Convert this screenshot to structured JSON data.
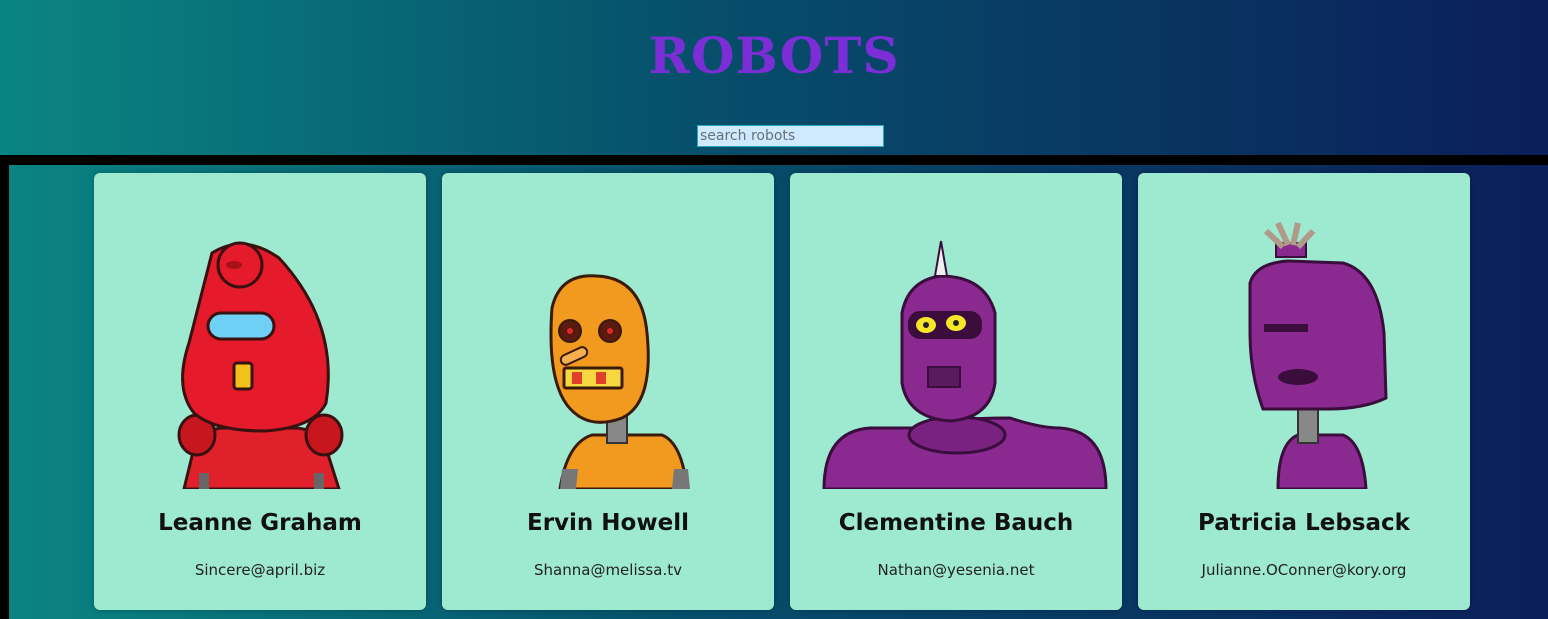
{
  "header": {
    "title": "ROBOTS",
    "search_placeholder": "search robots",
    "search_value": ""
  },
  "robots": [
    {
      "name": "Leanne Graham",
      "email": "Sincere@april.biz",
      "avatar": "red-robot-avatar"
    },
    {
      "name": "Ervin Howell",
      "email": "Shanna@melissa.tv",
      "avatar": "orange-robot-avatar"
    },
    {
      "name": "Clementine Bauch",
      "email": "Nathan@yesenia.net",
      "avatar": "purple-horned-robot-avatar"
    },
    {
      "name": "Patricia Lebsack",
      "email": "Julianne.OConner@kory.org",
      "avatar": "purple-tall-robot-avatar"
    }
  ],
  "colors": {
    "title": "#7b2ed6",
    "card_bg": "#9eead0",
    "gradient_start": "#0a8582",
    "gradient_end": "#0b1f5a"
  }
}
